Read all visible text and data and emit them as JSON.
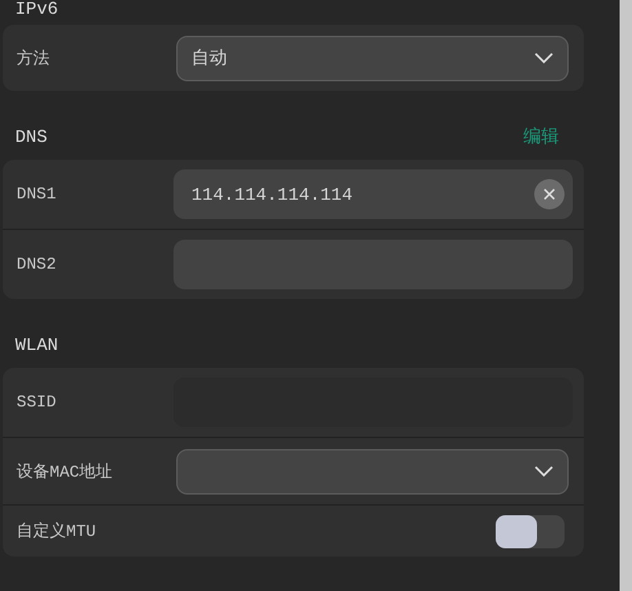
{
  "sections": [
    {
      "title": "IPv6",
      "rows": [
        {
          "kind": "select",
          "label": "方法",
          "value": "自动"
        }
      ]
    },
    {
      "title": "DNS",
      "action": "编辑",
      "rows": [
        {
          "kind": "input",
          "label": "DNS1",
          "value": "114.114.114.114",
          "clearable": true,
          "disabled": false
        },
        {
          "kind": "input",
          "label": "DNS2",
          "clearable": false,
          "disabled": false
        }
      ]
    },
    {
      "title": "WLAN",
      "rows": [
        {
          "kind": "input",
          "label": "SSID",
          "clearable": false,
          "disabled": true
        },
        {
          "kind": "select",
          "label": "设备MAC地址"
        },
        {
          "kind": "toggle",
          "label": "自定义MTU",
          "on": false
        }
      ]
    }
  ]
}
